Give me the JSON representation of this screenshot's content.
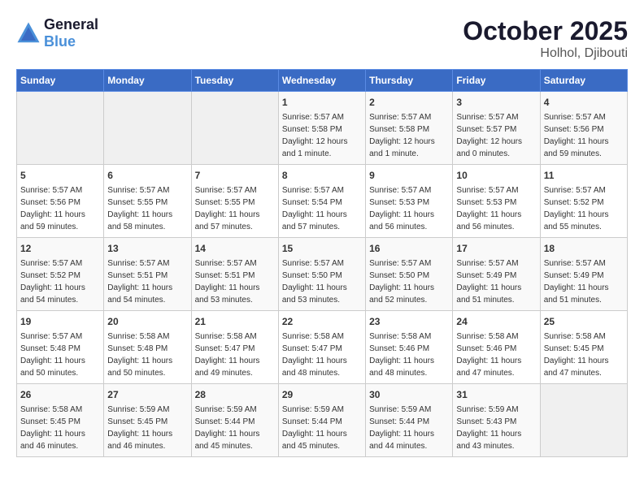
{
  "logo": {
    "line1": "General",
    "line2": "Blue"
  },
  "month": "October 2025",
  "location": "Holhol, Djibouti",
  "weekdays": [
    "Sunday",
    "Monday",
    "Tuesday",
    "Wednesday",
    "Thursday",
    "Friday",
    "Saturday"
  ],
  "weeks": [
    [
      {
        "day": "",
        "info": ""
      },
      {
        "day": "",
        "info": ""
      },
      {
        "day": "",
        "info": ""
      },
      {
        "day": "1",
        "info": "Sunrise: 5:57 AM\nSunset: 5:58 PM\nDaylight: 12 hours\nand 1 minute."
      },
      {
        "day": "2",
        "info": "Sunrise: 5:57 AM\nSunset: 5:58 PM\nDaylight: 12 hours\nand 1 minute."
      },
      {
        "day": "3",
        "info": "Sunrise: 5:57 AM\nSunset: 5:57 PM\nDaylight: 12 hours\nand 0 minutes."
      },
      {
        "day": "4",
        "info": "Sunrise: 5:57 AM\nSunset: 5:56 PM\nDaylight: 11 hours\nand 59 minutes."
      }
    ],
    [
      {
        "day": "5",
        "info": "Sunrise: 5:57 AM\nSunset: 5:56 PM\nDaylight: 11 hours\nand 59 minutes."
      },
      {
        "day": "6",
        "info": "Sunrise: 5:57 AM\nSunset: 5:55 PM\nDaylight: 11 hours\nand 58 minutes."
      },
      {
        "day": "7",
        "info": "Sunrise: 5:57 AM\nSunset: 5:55 PM\nDaylight: 11 hours\nand 57 minutes."
      },
      {
        "day": "8",
        "info": "Sunrise: 5:57 AM\nSunset: 5:54 PM\nDaylight: 11 hours\nand 57 minutes."
      },
      {
        "day": "9",
        "info": "Sunrise: 5:57 AM\nSunset: 5:53 PM\nDaylight: 11 hours\nand 56 minutes."
      },
      {
        "day": "10",
        "info": "Sunrise: 5:57 AM\nSunset: 5:53 PM\nDaylight: 11 hours\nand 56 minutes."
      },
      {
        "day": "11",
        "info": "Sunrise: 5:57 AM\nSunset: 5:52 PM\nDaylight: 11 hours\nand 55 minutes."
      }
    ],
    [
      {
        "day": "12",
        "info": "Sunrise: 5:57 AM\nSunset: 5:52 PM\nDaylight: 11 hours\nand 54 minutes."
      },
      {
        "day": "13",
        "info": "Sunrise: 5:57 AM\nSunset: 5:51 PM\nDaylight: 11 hours\nand 54 minutes."
      },
      {
        "day": "14",
        "info": "Sunrise: 5:57 AM\nSunset: 5:51 PM\nDaylight: 11 hours\nand 53 minutes."
      },
      {
        "day": "15",
        "info": "Sunrise: 5:57 AM\nSunset: 5:50 PM\nDaylight: 11 hours\nand 53 minutes."
      },
      {
        "day": "16",
        "info": "Sunrise: 5:57 AM\nSunset: 5:50 PM\nDaylight: 11 hours\nand 52 minutes."
      },
      {
        "day": "17",
        "info": "Sunrise: 5:57 AM\nSunset: 5:49 PM\nDaylight: 11 hours\nand 51 minutes."
      },
      {
        "day": "18",
        "info": "Sunrise: 5:57 AM\nSunset: 5:49 PM\nDaylight: 11 hours\nand 51 minutes."
      }
    ],
    [
      {
        "day": "19",
        "info": "Sunrise: 5:57 AM\nSunset: 5:48 PM\nDaylight: 11 hours\nand 50 minutes."
      },
      {
        "day": "20",
        "info": "Sunrise: 5:58 AM\nSunset: 5:48 PM\nDaylight: 11 hours\nand 50 minutes."
      },
      {
        "day": "21",
        "info": "Sunrise: 5:58 AM\nSunset: 5:47 PM\nDaylight: 11 hours\nand 49 minutes."
      },
      {
        "day": "22",
        "info": "Sunrise: 5:58 AM\nSunset: 5:47 PM\nDaylight: 11 hours\nand 48 minutes."
      },
      {
        "day": "23",
        "info": "Sunrise: 5:58 AM\nSunset: 5:46 PM\nDaylight: 11 hours\nand 48 minutes."
      },
      {
        "day": "24",
        "info": "Sunrise: 5:58 AM\nSunset: 5:46 PM\nDaylight: 11 hours\nand 47 minutes."
      },
      {
        "day": "25",
        "info": "Sunrise: 5:58 AM\nSunset: 5:45 PM\nDaylight: 11 hours\nand 47 minutes."
      }
    ],
    [
      {
        "day": "26",
        "info": "Sunrise: 5:58 AM\nSunset: 5:45 PM\nDaylight: 11 hours\nand 46 minutes."
      },
      {
        "day": "27",
        "info": "Sunrise: 5:59 AM\nSunset: 5:45 PM\nDaylight: 11 hours\nand 46 minutes."
      },
      {
        "day": "28",
        "info": "Sunrise: 5:59 AM\nSunset: 5:44 PM\nDaylight: 11 hours\nand 45 minutes."
      },
      {
        "day": "29",
        "info": "Sunrise: 5:59 AM\nSunset: 5:44 PM\nDaylight: 11 hours\nand 45 minutes."
      },
      {
        "day": "30",
        "info": "Sunrise: 5:59 AM\nSunset: 5:44 PM\nDaylight: 11 hours\nand 44 minutes."
      },
      {
        "day": "31",
        "info": "Sunrise: 5:59 AM\nSunset: 5:43 PM\nDaylight: 11 hours\nand 43 minutes."
      },
      {
        "day": "",
        "info": ""
      }
    ]
  ]
}
